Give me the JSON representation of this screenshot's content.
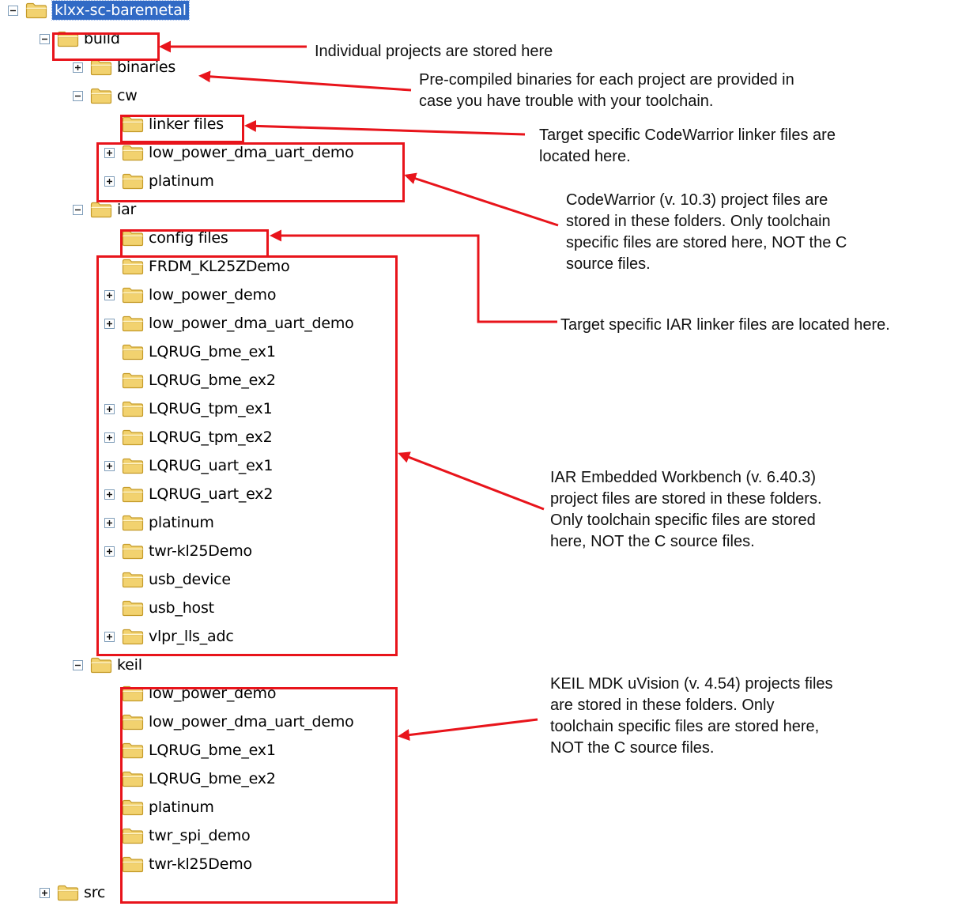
{
  "colors": {
    "highlight": "#e8141b",
    "selection": "#316ac5",
    "folder_fill": "#f2d26f",
    "folder_stroke": "#c49a28"
  },
  "tree": [
    {
      "label": "klxx-sc-baremetal",
      "depth": 0,
      "toggle": "minus",
      "selected": true
    },
    {
      "label": "build",
      "depth": 1,
      "toggle": "minus"
    },
    {
      "label": "binaries",
      "depth": 2,
      "toggle": "plus"
    },
    {
      "label": "cw",
      "depth": 2,
      "toggle": "minus"
    },
    {
      "label": "linker files",
      "depth": 3,
      "toggle": "none"
    },
    {
      "label": "low_power_dma_uart_demo",
      "depth": 3,
      "toggle": "plus"
    },
    {
      "label": "platinum",
      "depth": 3,
      "toggle": "plus"
    },
    {
      "label": "iar",
      "depth": 2,
      "toggle": "minus"
    },
    {
      "label": "config files",
      "depth": 3,
      "toggle": "none"
    },
    {
      "label": "FRDM_KL25ZDemo",
      "depth": 3,
      "toggle": "none"
    },
    {
      "label": "low_power_demo",
      "depth": 3,
      "toggle": "plus"
    },
    {
      "label": "low_power_dma_uart_demo",
      "depth": 3,
      "toggle": "plus"
    },
    {
      "label": "LQRUG_bme_ex1",
      "depth": 3,
      "toggle": "none"
    },
    {
      "label": "LQRUG_bme_ex2",
      "depth": 3,
      "toggle": "none"
    },
    {
      "label": "LQRUG_tpm_ex1",
      "depth": 3,
      "toggle": "plus"
    },
    {
      "label": "LQRUG_tpm_ex2",
      "depth": 3,
      "toggle": "plus"
    },
    {
      "label": "LQRUG_uart_ex1",
      "depth": 3,
      "toggle": "plus"
    },
    {
      "label": "LQRUG_uart_ex2",
      "depth": 3,
      "toggle": "plus"
    },
    {
      "label": "platinum",
      "depth": 3,
      "toggle": "plus"
    },
    {
      "label": "twr-kl25Demo",
      "depth": 3,
      "toggle": "plus"
    },
    {
      "label": "usb_device",
      "depth": 3,
      "toggle": "none"
    },
    {
      "label": "usb_host",
      "depth": 3,
      "toggle": "none"
    },
    {
      "label": "vlpr_lls_adc",
      "depth": 3,
      "toggle": "plus"
    },
    {
      "label": "keil",
      "depth": 2,
      "toggle": "minus"
    },
    {
      "label": "low_power_demo",
      "depth": 3,
      "toggle": "none"
    },
    {
      "label": "low_power_dma_uart_demo",
      "depth": 3,
      "toggle": "none"
    },
    {
      "label": "LQRUG_bme_ex1",
      "depth": 3,
      "toggle": "none"
    },
    {
      "label": "LQRUG_bme_ex2",
      "depth": 3,
      "toggle": "none"
    },
    {
      "label": "platinum",
      "depth": 3,
      "toggle": "none"
    },
    {
      "label": "twr_spi_demo",
      "depth": 3,
      "toggle": "none"
    },
    {
      "label": "twr-kl25Demo",
      "depth": 3,
      "toggle": "none"
    },
    {
      "label": "src",
      "depth": 1,
      "toggle": "plus"
    }
  ],
  "annotations": [
    {
      "id": "build",
      "lines": [
        "Individual projects are stored here"
      ]
    },
    {
      "id": "binaries",
      "lines": [
        "Pre-compiled binaries for each project are provided in",
        "case you have trouble with your toolchain."
      ]
    },
    {
      "id": "cw-linker",
      "lines": [
        "Target specific CodeWarrior linker files are",
        "located here."
      ]
    },
    {
      "id": "cw-projects",
      "lines": [
        "CodeWarrior (v. 10.3) project files are",
        "stored in these folders. Only toolchain",
        "specific files are stored here, NOT the C",
        "source files."
      ]
    },
    {
      "id": "iar-config",
      "lines": [
        "Target specific IAR linker files are located here."
      ]
    },
    {
      "id": "iar-projects",
      "lines": [
        "IAR Embedded Workbench (v. 6.40.3)",
        "project files are stored in these folders.",
        "Only toolchain specific files are stored",
        "here, NOT the C source files."
      ]
    },
    {
      "id": "keil-projects",
      "lines": [
        "KEIL MDK uVision (v. 4.54) projects files",
        "are stored in these folders. Only",
        "toolchain specific files are stored here,",
        "NOT the C source files."
      ]
    }
  ]
}
